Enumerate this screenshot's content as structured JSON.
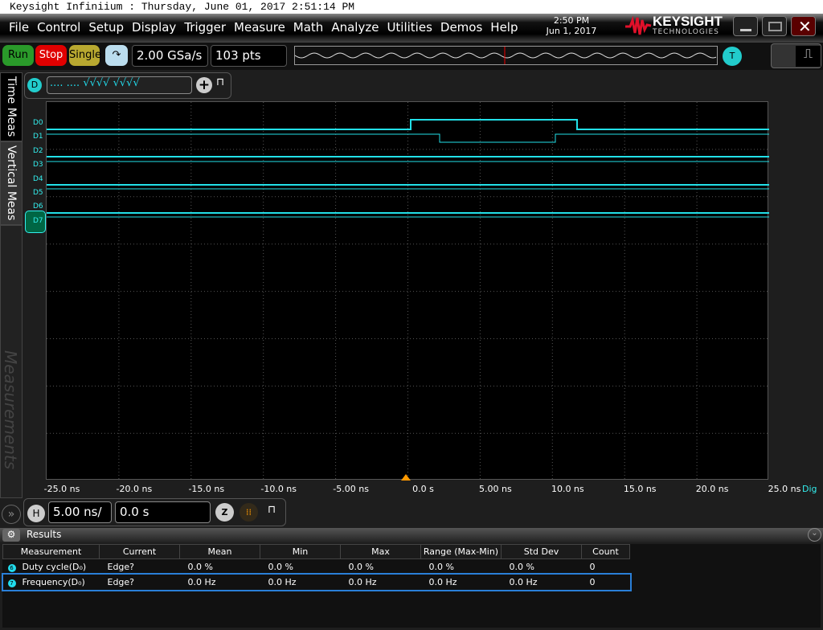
{
  "window_title": "Keysight Infiniium : Thursday, June 01, 2017 2:51:14 PM",
  "menu": [
    "File",
    "Control",
    "Setup",
    "Display",
    "Trigger",
    "Measure",
    "Math",
    "Analyze",
    "Utilities",
    "Demos",
    "Help"
  ],
  "clock": {
    "time": "2:50 PM",
    "date": "Jun 1, 2017"
  },
  "logo": {
    "name": "KEYSIGHT",
    "sub": "TECHNOLOGIES"
  },
  "toolbar": {
    "run": "Run",
    "stop": "Stop",
    "single": "Single",
    "sample_rate": "2.00 GSa/s",
    "points": "103 pts",
    "trigger_label": "T"
  },
  "digital": {
    "label": "D",
    "bits": ".... .... √√√√ √√√√",
    "channels": [
      "D0",
      "D1",
      "D2",
      "D3",
      "D4",
      "D5",
      "D6",
      "D7"
    ],
    "selected": "D7"
  },
  "side_tabs": [
    "Time Meas",
    "Vertical Meas",
    "Measurements"
  ],
  "x_axis": {
    "ticks": [
      "-25.0 ns",
      "-20.0 ns",
      "-15.0 ns",
      "-10.0 ns",
      "-5.00 ns",
      "0.0 s",
      "5.00 ns",
      "10.0 ns",
      "15.0 ns",
      "20.0 ns",
      "25.0 ns"
    ],
    "unit_label": "Dig"
  },
  "horizontal": {
    "label": "H",
    "scale": "5.00 ns/",
    "position": "0.0 s"
  },
  "results": {
    "title": "Results",
    "columns": [
      "Measurement",
      "Current",
      "Mean",
      "Min",
      "Max",
      "Range (Max-Min)",
      "Std Dev",
      "Count"
    ],
    "rows": [
      {
        "id": "6",
        "cells": [
          "Duty cycle(D₀)",
          "Edge?",
          "0.0 %",
          "0.0 %",
          "0.0 %",
          "0.0 %",
          "0.0 %",
          "0"
        ]
      },
      {
        "id": "7",
        "cells": [
          "Frequency(D₀)",
          "Edge?",
          "0.0 Hz",
          "0.0 Hz",
          "0.0 Hz",
          "0.0 Hz",
          "0.0 Hz",
          "0"
        ]
      }
    ]
  },
  "colors": {
    "trace": "#22e0e8",
    "stop": "#e00000",
    "run": "#2a9a2a",
    "single": "#b8a830",
    "logo_red": "#e0102a"
  }
}
